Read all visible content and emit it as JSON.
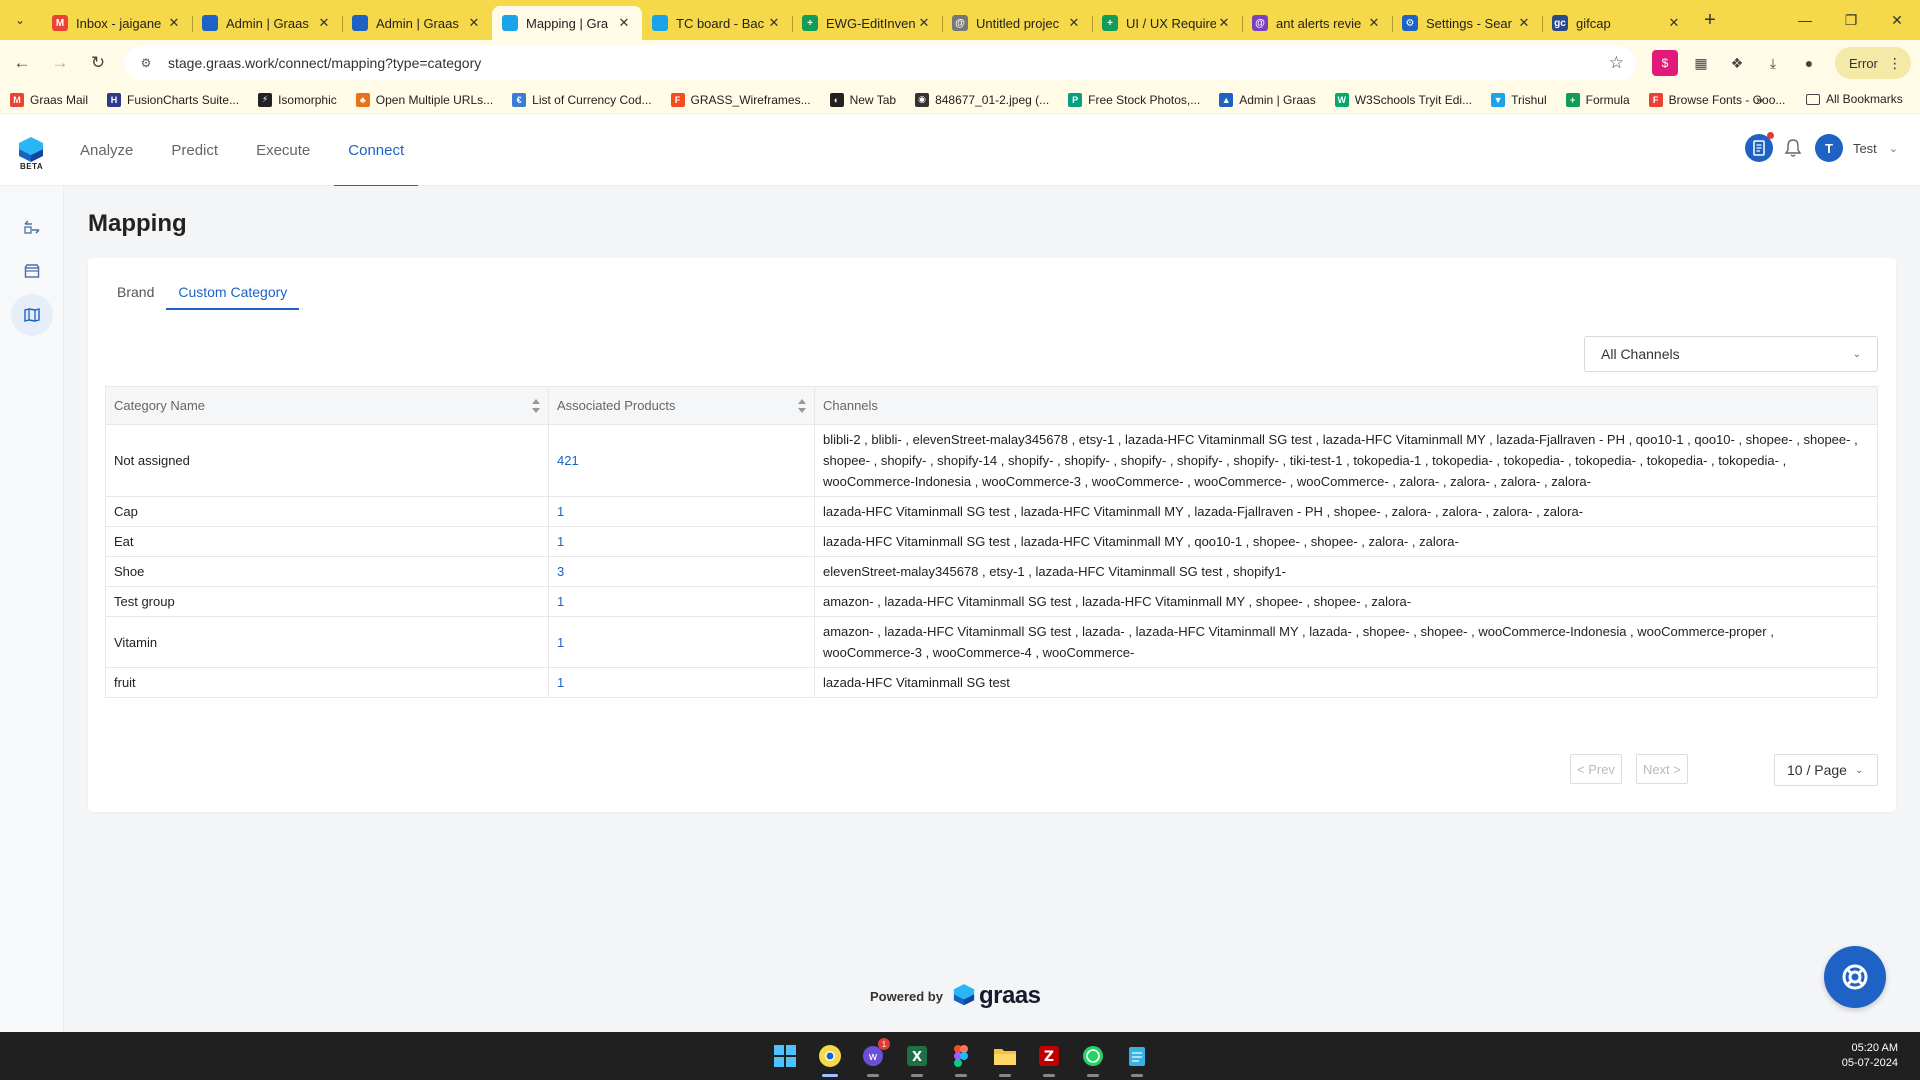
{
  "browser": {
    "tabs": [
      {
        "title": "Inbox - jaigane",
        "favicon": "gmail-icon",
        "color": "#ea4335",
        "glyph": "M"
      },
      {
        "title": "Admin | Graas",
        "favicon": "person-icon",
        "color": "#1d62c4",
        "glyph": ""
      },
      {
        "title": "Admin | Graas",
        "favicon": "person-icon",
        "color": "#1d62c4",
        "glyph": ""
      },
      {
        "title": "Mapping | Gra",
        "favicon": "graas-icon",
        "color": "#1aa3e8",
        "glyph": "",
        "active": true
      },
      {
        "title": "TC board - Bac",
        "favicon": "graas-icon",
        "color": "#1aa3e8",
        "glyph": ""
      },
      {
        "title": "EWG-EditInven",
        "favicon": "sheets-icon",
        "color": "#0f9d58",
        "glyph": "+"
      },
      {
        "title": "Untitled projec",
        "favicon": "project-icon",
        "color": "#777777",
        "glyph": "@"
      },
      {
        "title": "UI / UX Require",
        "favicon": "sheets-icon",
        "color": "#0f9d58",
        "glyph": "+"
      },
      {
        "title": "ant alerts revie",
        "favicon": "project-icon",
        "color": "#7b3fbf",
        "glyph": "@"
      },
      {
        "title": "Settings - Sear",
        "favicon": "gear-icon",
        "color": "#1d62c4",
        "glyph": "⚙"
      },
      {
        "title": "gifcap",
        "favicon": "gifcap-icon",
        "color": "#2b4a8b",
        "glyph": "gc"
      }
    ],
    "new_tab": "+",
    "url": "stage.graas.work/connect/mapping?type=category",
    "error_label": "Error",
    "bookmarks": [
      {
        "label": "Graas Mail",
        "color": "#ea4335",
        "glyph": "M"
      },
      {
        "label": "FusionCharts Suite...",
        "color": "#2d3a8c",
        "glyph": "H"
      },
      {
        "label": "Isomorphic",
        "color": "#222222",
        "glyph": "⚡"
      },
      {
        "label": "Open Multiple URLs...",
        "color": "#e8711a",
        "glyph": "♣"
      },
      {
        "label": "List of Currency Cod...",
        "color": "#3a7bd5",
        "glyph": "€"
      },
      {
        "label": "GRASS_Wireframes...",
        "color": "#f24e1e",
        "glyph": "F"
      },
      {
        "label": "New Tab",
        "color": "#222222",
        "glyph": "◐"
      },
      {
        "label": "848677_01-2.jpeg (...",
        "color": "#333333",
        "glyph": "◉"
      },
      {
        "label": "Free Stock Photos,...",
        "color": "#05a081",
        "glyph": "P"
      },
      {
        "label": "Admin | Graas",
        "color": "#1d62c4",
        "glyph": "▲"
      },
      {
        "label": "W3Schools Tryit Edi...",
        "color": "#04aa6d",
        "glyph": "W"
      },
      {
        "label": "Trishul",
        "color": "#1aa3e8",
        "glyph": "▼"
      },
      {
        "label": "Formula",
        "color": "#0f9d58",
        "glyph": "+"
      },
      {
        "label": "Browse Fonts - Goo...",
        "color": "#e94235",
        "glyph": "F"
      }
    ],
    "more_bookmarks": "»",
    "all_bookmarks": "All Bookmarks"
  },
  "app": {
    "beta": "BETA",
    "nav": [
      "Analyze",
      "Predict",
      "Execute",
      "Connect"
    ],
    "active_nav": "Connect",
    "user_initial": "T",
    "user_name": "Test"
  },
  "page": {
    "title": "Mapping",
    "subtabs": [
      "Brand",
      "Custom Category"
    ],
    "active_subtab": "Custom Category",
    "channel_filter": "All Channels",
    "columns": [
      "Category Name",
      "Associated Products",
      "Channels"
    ],
    "rows": [
      {
        "name": "Not assigned",
        "count": "421",
        "channels": "blibli-2 , blibli- , elevenStreet-malay345678 , etsy-1 , lazada-HFC Vitaminmall SG test , lazada-HFC Vitaminmall MY , lazada-Fjallraven - PH , qoo10-1 , qoo10- , shopee- , shopee- , shopee- , shopify- , shopify-14 , shopify- , shopify- , shopify- , shopify- , shopify- , tiki-test-1 , tokopedia-1 , tokopedia- , tokopedia- , tokopedia- , tokopedia- , tokopedia- , wooCommerce-Indonesia , wooCommerce-3 , wooCommerce- , wooCommerce- , wooCommerce- , zalora- , zalora- , zalora- , zalora-"
      },
      {
        "name": "Cap",
        "count": "1",
        "channels": "lazada-HFC Vitaminmall SG test , lazada-HFC Vitaminmall MY , lazada-Fjallraven - PH , shopee- , zalora- , zalora- , zalora- , zalora-"
      },
      {
        "name": "Eat",
        "count": "1",
        "channels": "lazada-HFC Vitaminmall SG test , lazada-HFC Vitaminmall MY , qoo10-1 , shopee- , shopee- , zalora- , zalora-"
      },
      {
        "name": "Shoe",
        "count": "3",
        "channels": "elevenStreet-malay345678 , etsy-1 , lazada-HFC Vitaminmall SG test , shopify1-"
      },
      {
        "name": "Test group",
        "count": "1",
        "channels": "amazon- , lazada-HFC Vitaminmall SG test , lazada-HFC Vitaminmall MY , shopee- , shopee- , zalora-"
      },
      {
        "name": "Vitamin",
        "count": "1",
        "channels": "amazon- , lazada-HFC Vitaminmall SG test , lazada- , lazada-HFC Vitaminmall MY , lazada- , shopee- , shopee- , wooCommerce-Indonesia , wooCommerce-proper , wooCommerce-3 , wooCommerce-4 , wooCommerce-"
      },
      {
        "name": "fruit",
        "count": "1",
        "channels": "lazada-HFC Vitaminmall SG test"
      }
    ],
    "prev_label": "< Prev",
    "next_label": "Next >",
    "page_size": "10 / Page",
    "powered_by": "Powered by",
    "brand": "graas"
  },
  "taskbar": {
    "time": "05:20 AM",
    "date": "05-07-2024",
    "badge_count": "1"
  },
  "colors": {
    "accent": "#1d62c4",
    "tabbar": "#f6d94a",
    "toolbar": "#fffbe6"
  }
}
